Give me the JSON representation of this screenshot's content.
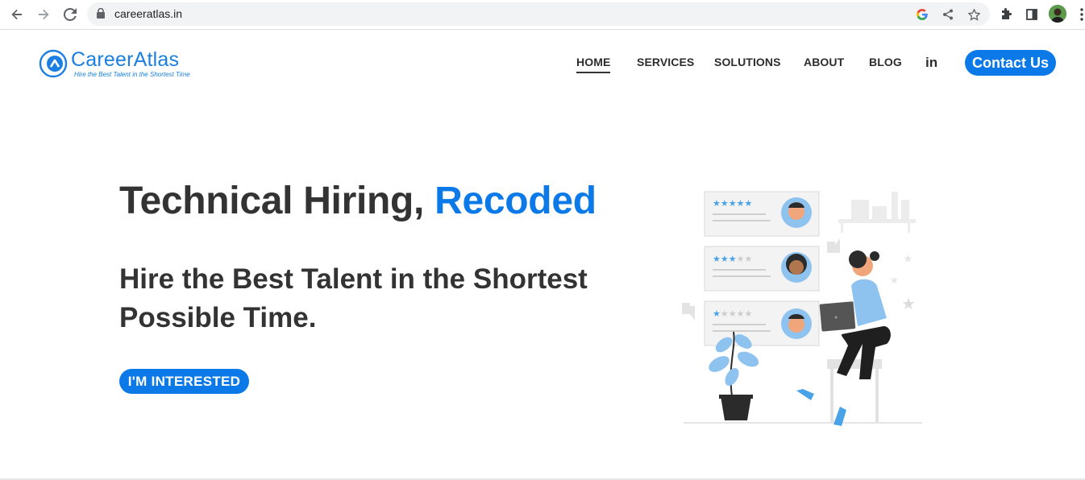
{
  "browser": {
    "url": "careeratlas.in"
  },
  "site": {
    "logo_name": "CareerAtlas",
    "logo_tagline": "Hire the Best Talent in the Shortest Time"
  },
  "nav": {
    "items": [
      {
        "label": "HOME",
        "active": true
      },
      {
        "label": "SERVICES",
        "active": false
      },
      {
        "label": "SOLUTIONS",
        "active": false
      },
      {
        "label": "ABOUT",
        "active": false
      },
      {
        "label": "BLOG",
        "active": false
      }
    ],
    "linkedin_label": "in",
    "contact_label": "Contact Us"
  },
  "hero": {
    "title_main": "Technical Hiring, ",
    "title_accent": "Recoded",
    "subtitle": "Hire the Best Talent in the Shortest Possible Time.",
    "cta_label": "I'M INTERESTED"
  },
  "colors": {
    "brand_blue": "#0b7ae8",
    "text_dark": "#333333"
  },
  "icons": [
    "back-arrow-icon",
    "forward-arrow-icon",
    "reload-icon",
    "lock-icon",
    "google-icon",
    "share-icon",
    "star-bookmark-icon",
    "extensions-icon",
    "side-panel-icon",
    "profile-avatar",
    "more-menu-icon",
    "linkedin-icon"
  ],
  "illustration": {
    "rating_cards": [
      {
        "stars_filled": 5
      },
      {
        "stars_filled": 3
      },
      {
        "stars_filled": 1
      }
    ]
  }
}
